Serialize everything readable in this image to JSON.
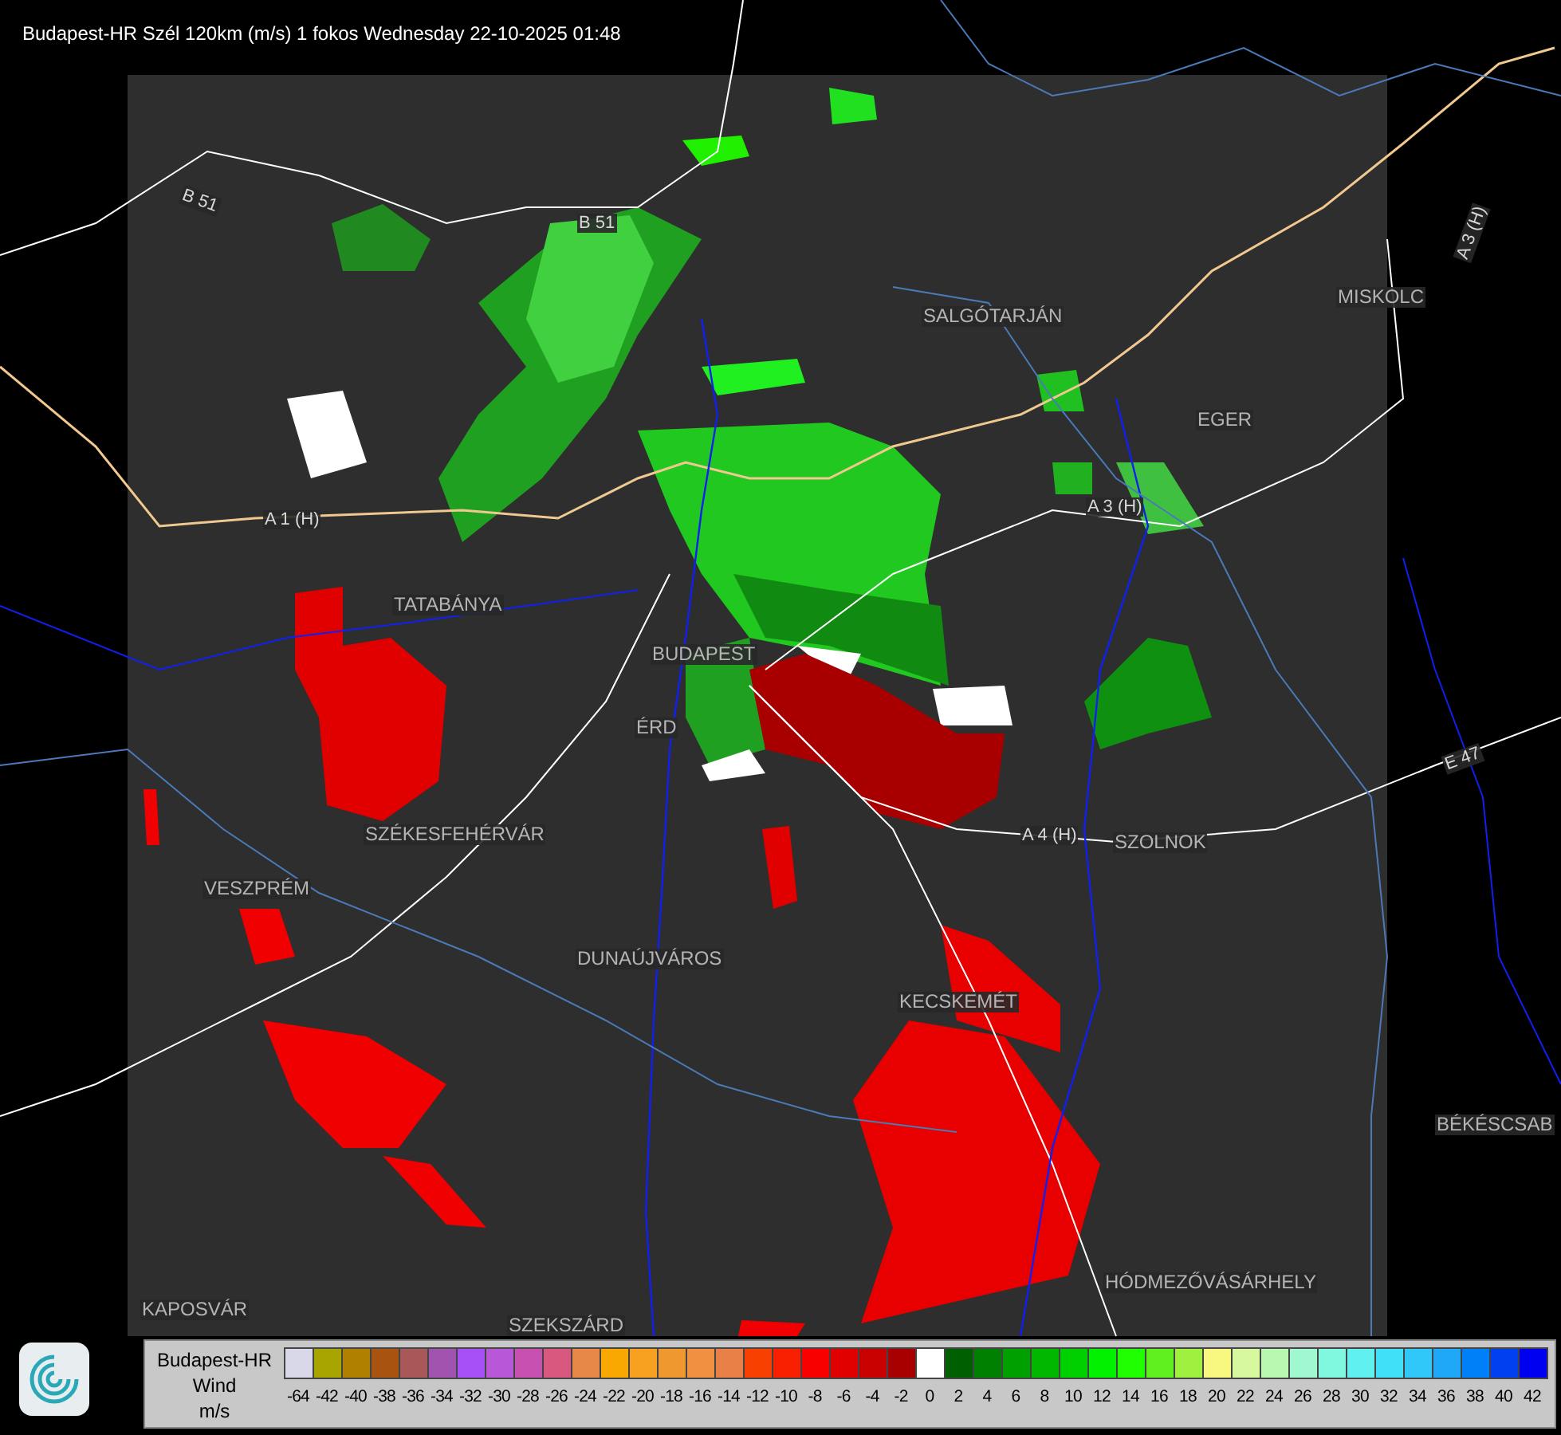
{
  "title": "Budapest-HR Szél 120km (m/s) 1 fokos Wednesday 22-10-2025 01:48",
  "map": {
    "places": [
      {
        "label": "SALGÓTARJÁN"
      },
      {
        "label": "MISKOLC"
      },
      {
        "label": "EGER"
      },
      {
        "label": "TATABÁNYA"
      },
      {
        "label": "BUDAPEST"
      },
      {
        "label": "ÉRD"
      },
      {
        "label": "SZÉKESFEHÉRVÁR"
      },
      {
        "label": "VESZPRÉM"
      },
      {
        "label": "DUNAÚJVÁROS"
      },
      {
        "label": "KECSKEMÉT"
      },
      {
        "label": "SZOLNOK"
      },
      {
        "label": "KAPOSVÁR"
      },
      {
        "label": "SZEKSZÁRD"
      },
      {
        "label": "HÓDMEZŐVÁSÁRHELY"
      },
      {
        "label": "BÉKÉSCSAB"
      }
    ],
    "roads": [
      {
        "label": "B 51"
      },
      {
        "label": "B 51"
      },
      {
        "label": "A 1 (H)"
      },
      {
        "label": "A 3 (H)"
      },
      {
        "label": "A 4 (H)"
      },
      {
        "label": "E 47"
      },
      {
        "label": "A 3 (H)"
      }
    ]
  },
  "legend": {
    "station": "Budapest-HR",
    "quantity": "Wind",
    "unit": "m/s",
    "swatches": [
      {
        "label": "-64",
        "color": "#d8d8e8"
      },
      {
        "label": "-42",
        "color": "#a8a400"
      },
      {
        "label": "-40",
        "color": "#b08000"
      },
      {
        "label": "-38",
        "color": "#a85410"
      },
      {
        "label": "-36",
        "color": "#a85858"
      },
      {
        "label": "-34",
        "color": "#a054b0"
      },
      {
        "label": "-32",
        "color": "#a850f8"
      },
      {
        "label": "-30",
        "color": "#b858d8"
      },
      {
        "label": "-28",
        "color": "#c850b0"
      },
      {
        "label": "-26",
        "color": "#d85880"
      },
      {
        "label": "-24",
        "color": "#e88848"
      },
      {
        "label": "-22",
        "color": "#f8a800"
      },
      {
        "label": "-20",
        "color": "#f8a020"
      },
      {
        "label": "-18",
        "color": "#f09830"
      },
      {
        "label": "-16",
        "color": "#f09040"
      },
      {
        "label": "-14",
        "color": "#e88048"
      },
      {
        "label": "-12",
        "color": "#f84000"
      },
      {
        "label": "-10",
        "color": "#f82000"
      },
      {
        "label": "-8",
        "color": "#f80000"
      },
      {
        "label": "-6",
        "color": "#e00000"
      },
      {
        "label": "-4",
        "color": "#c80000"
      },
      {
        "label": "-2",
        "color": "#a80000"
      },
      {
        "label": "0",
        "color": "#ffffff"
      },
      {
        "label": "2",
        "color": "#006000"
      },
      {
        "label": "4",
        "color": "#008000"
      },
      {
        "label": "6",
        "color": "#00a000"
      },
      {
        "label": "8",
        "color": "#00b800"
      },
      {
        "label": "10",
        "color": "#00d000"
      },
      {
        "label": "12",
        "color": "#00f000"
      },
      {
        "label": "14",
        "color": "#20ff00"
      },
      {
        "label": "16",
        "color": "#60f020"
      },
      {
        "label": "18",
        "color": "#a0f040"
      },
      {
        "label": "20",
        "color": "#f8f880"
      },
      {
        "label": "22",
        "color": "#d8f8a0"
      },
      {
        "label": "24",
        "color": "#b8f8b0"
      },
      {
        "label": "26",
        "color": "#a0f8d0"
      },
      {
        "label": "28",
        "color": "#80f8e0"
      },
      {
        "label": "30",
        "color": "#60f0f0"
      },
      {
        "label": "32",
        "color": "#40e0f8"
      },
      {
        "label": "34",
        "color": "#30c8f8"
      },
      {
        "label": "36",
        "color": "#20a8f8"
      },
      {
        "label": "38",
        "color": "#0080f8"
      },
      {
        "label": "40",
        "color": "#0040f0"
      },
      {
        "label": "42",
        "color": "#0000f0"
      }
    ]
  }
}
